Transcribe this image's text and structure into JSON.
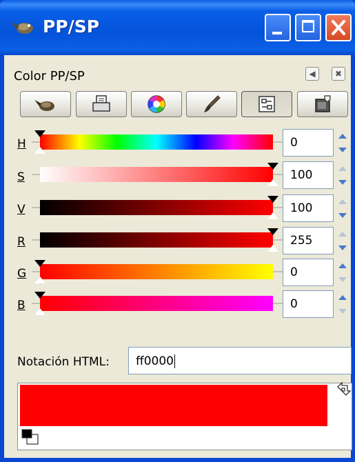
{
  "window": {
    "title": "PP/SP"
  },
  "dock": {
    "title": "Color PP/SP",
    "tabs": [
      {
        "name": "gimp-selector-tab",
        "active": false
      },
      {
        "name": "cmyk-selector-tab",
        "active": false
      },
      {
        "name": "watercolor-selector-tab",
        "active": false
      },
      {
        "name": "brush-selector-tab",
        "active": false
      },
      {
        "name": "scales-selector-tab",
        "active": true
      },
      {
        "name": "palette-selector-tab",
        "active": false
      }
    ]
  },
  "channels": [
    {
      "label": "H",
      "value": "0"
    },
    {
      "label": "S",
      "value": "100"
    },
    {
      "label": "V",
      "value": "100"
    },
    {
      "label": "R",
      "value": "255"
    },
    {
      "label": "G",
      "value": "0"
    },
    {
      "label": "B",
      "value": "0"
    }
  ],
  "html_notation": {
    "label": "Notación HTML:",
    "value": "ff0000"
  },
  "colors": {
    "foreground": "#ff0000",
    "background": "#ffffff"
  }
}
